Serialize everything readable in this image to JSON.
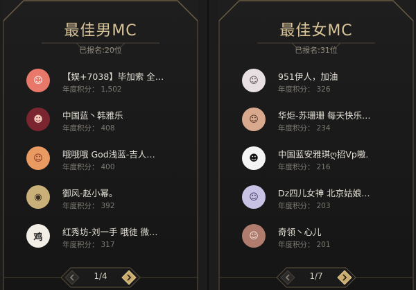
{
  "male": {
    "title": "最佳男MC",
    "subtitle": "已报名:20位",
    "score_label": "年度积分：",
    "items": [
      {
        "name": "【娱+7038】毕加索 全…",
        "score": "1,502",
        "avatar_bg": "#e8796a",
        "avatar_fg": "#ffffff",
        "avatar_glyph": "☺"
      },
      {
        "name": "中国蓝丶韩雅乐",
        "score": "408",
        "avatar_bg": "#7a2530",
        "avatar_fg": "#f2c9b8",
        "avatar_glyph": "☻"
      },
      {
        "name": "哦哦哦 God浅蓝-吉人…",
        "score": "400",
        "avatar_bg": "#e89a60",
        "avatar_fg": "#7a2d20",
        "avatar_glyph": "☺"
      },
      {
        "name": "御风-赵小幂。",
        "score": "392",
        "avatar_bg": "#c9b079",
        "avatar_fg": "#3b2f22",
        "avatar_glyph": "◉"
      },
      {
        "name": "红秀坊-刘一手 哦徒 微…",
        "score": "317",
        "avatar_bg": "#f2eee6",
        "avatar_fg": "#222222",
        "avatar_glyph": "鸡"
      }
    ],
    "pager": {
      "text": "1/4"
    }
  },
  "female": {
    "title": "最佳女MC",
    "subtitle": "已报名:31位",
    "score_label": "年度积分：",
    "items": [
      {
        "name": "951伊人，加油",
        "score": "326",
        "avatar_bg": "#e7dfe2",
        "avatar_fg": "#5a4b50",
        "avatar_glyph": "☺"
      },
      {
        "name": "华炬-苏珊珊 每天快乐…",
        "score": "234",
        "avatar_bg": "#d9a98e",
        "avatar_fg": "#4a2f25",
        "avatar_glyph": "☺"
      },
      {
        "name": "中国蓝安雅琪ღ招Vp嗷.",
        "score": "216",
        "avatar_bg": "#f4f4f4",
        "avatar_fg": "#111111",
        "avatar_glyph": "☻"
      },
      {
        "name": "Dz四儿女神 北京姑娘…",
        "score": "203",
        "avatar_bg": "#c8c2e4",
        "avatar_fg": "#3b3560",
        "avatar_glyph": "☺"
      },
      {
        "name": "奇领丶心儿",
        "score": "201",
        "avatar_bg": "#b07c6e",
        "avatar_fg": "#f6e7dd",
        "avatar_glyph": "☺"
      }
    ],
    "pager": {
      "text": "1/7"
    }
  },
  "colors": {
    "gold": "#d9c499",
    "frame": "#5d513b"
  }
}
